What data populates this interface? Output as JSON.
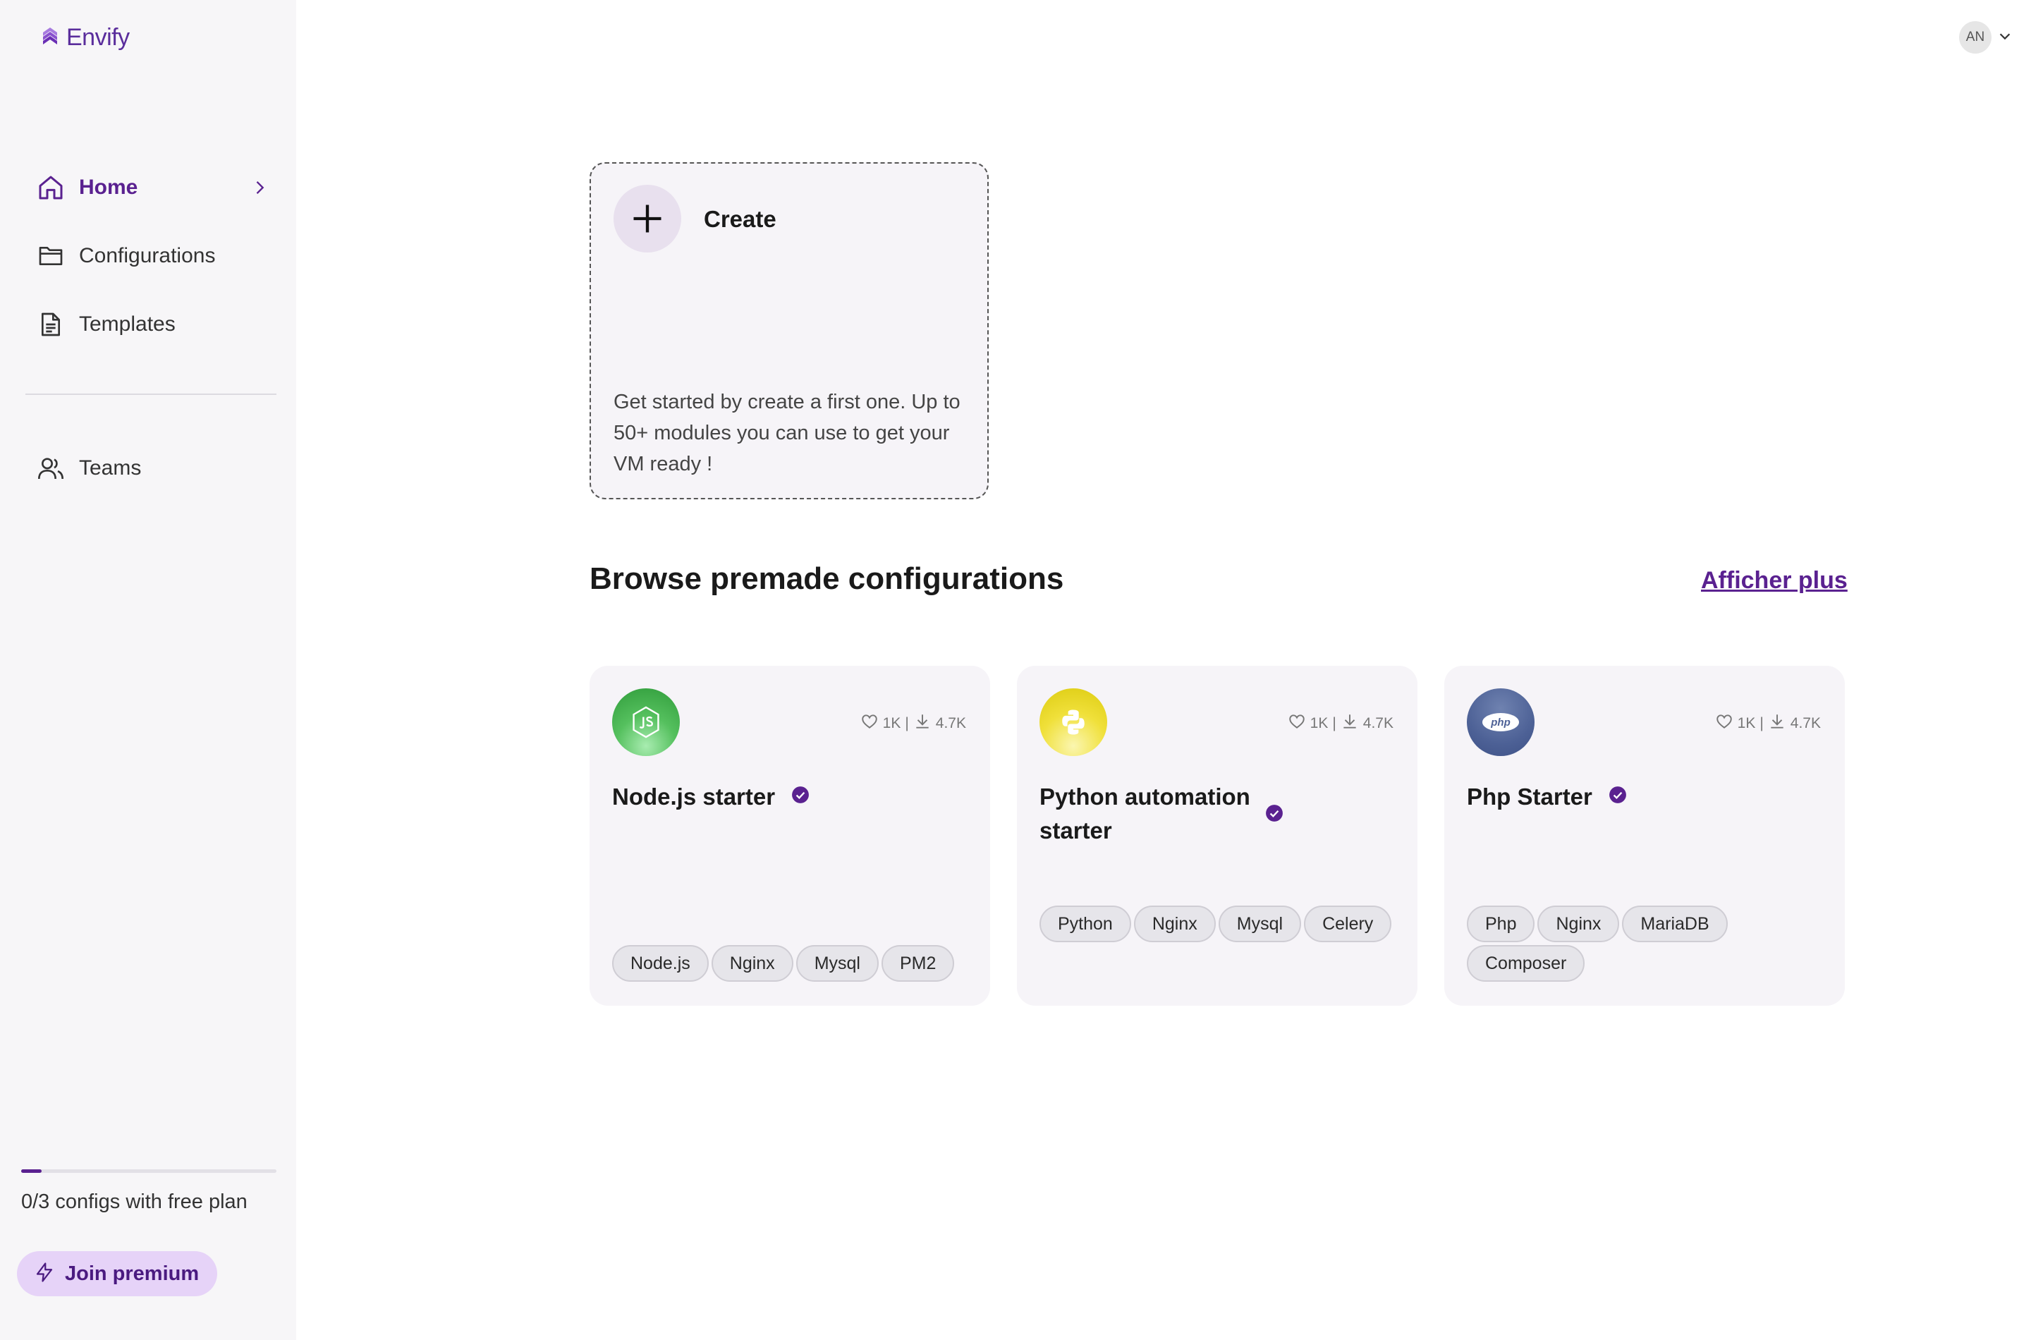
{
  "app": {
    "name": "Envify"
  },
  "user": {
    "initials": "AN"
  },
  "sidebar": {
    "items": [
      {
        "label": "Home"
      },
      {
        "label": "Configurations"
      },
      {
        "label": "Templates"
      },
      {
        "label": "Teams"
      }
    ],
    "plan_progress_fraction": 0.08,
    "plan_text": "0/3 configs with free plan",
    "premium_label": "Join premium"
  },
  "create": {
    "title": "Create",
    "description": "Get started by create a first one. Up to 50+ modules you can use to get your VM ready !"
  },
  "browse": {
    "title": "Browse premade configurations",
    "show_more": "Afficher plus",
    "cards": [
      {
        "title": "Node.js starter",
        "likes": "1K",
        "downloads": "4.7K",
        "icon": "nodejs-icon",
        "tags": [
          "Node.js",
          "Nginx",
          "Mysql",
          "PM2"
        ]
      },
      {
        "title": "Python automation starter",
        "likes": "1K",
        "downloads": "4.7K",
        "icon": "python-icon",
        "tags": [
          "Python",
          "Nginx",
          "Mysql",
          "Celery"
        ]
      },
      {
        "title": "Php Starter",
        "likes": "1K",
        "downloads": "4.7K",
        "icon": "php-icon",
        "icon_text": "php",
        "tags": [
          "Php",
          "Nginx",
          "MariaDB",
          "Composer"
        ]
      }
    ]
  },
  "colors": {
    "accent": "#5a2190",
    "premium_bg": "#e6d3f8",
    "sidebar_bg": "#f7f6f8",
    "card_bg": "#f6f4f8"
  }
}
